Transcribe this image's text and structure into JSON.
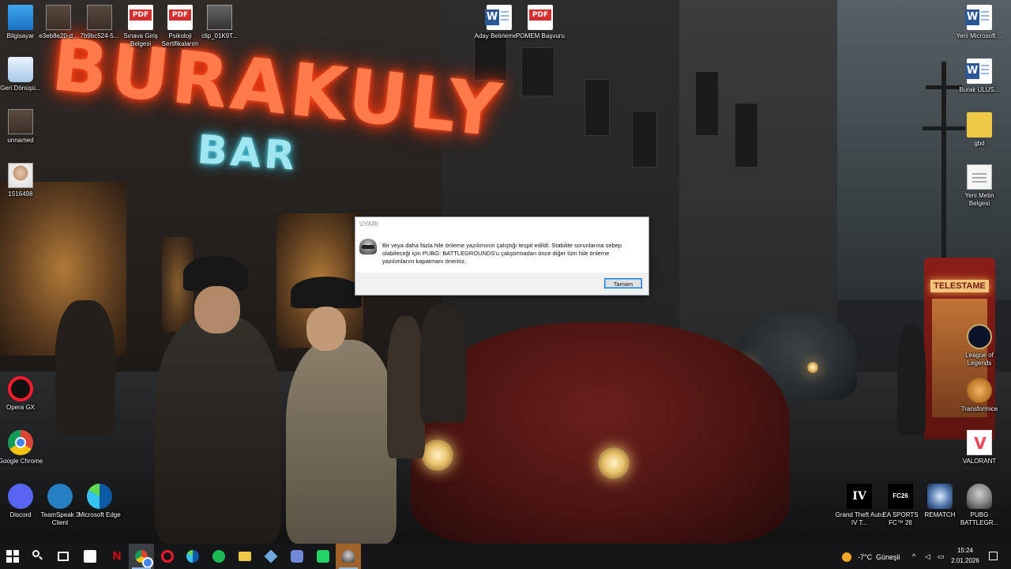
{
  "wallpaper": {
    "neon_title": "BURAKULY",
    "neon_sub": "BAR",
    "booth_sign": "TELESTAME"
  },
  "desktop_icons_left": [
    {
      "label": "Bilgisayar",
      "icon": "computer-icon"
    },
    {
      "label": "e3eb8e20-d...",
      "icon": "photo-icon"
    },
    {
      "label": "7b9bc524-5...",
      "icon": "photo-icon"
    },
    {
      "label": "Sınava Giriş Belgesi",
      "icon": "pdf-icon"
    },
    {
      "label": "Psikoloji Sertifikalarım",
      "icon": "pdf-icon"
    },
    {
      "label": "clip_01K9T...",
      "icon": "video-icon"
    },
    {
      "label": "Geri Dönüşü...",
      "icon": "recycle-bin-icon"
    },
    {
      "label": "unnamed",
      "icon": "photo-icon"
    },
    {
      "label": "1516498",
      "icon": "photo-icon"
    },
    {
      "label": "Opera GX",
      "icon": "opera-gx-icon"
    },
    {
      "label": "Google Chrome",
      "icon": "chrome-icon"
    },
    {
      "label": "Discord",
      "icon": "discord-icon"
    },
    {
      "label": "TeamSpeak 3 Client",
      "icon": "teamspeak-icon"
    },
    {
      "label": "Microsoft Edge",
      "icon": "edge-icon"
    }
  ],
  "desktop_icons_center": [
    {
      "label": "Aday Belirleme ...",
      "icon": "word-icon"
    },
    {
      "label": "POMEM Başvuru",
      "icon": "pdf-icon"
    }
  ],
  "desktop_icons_right": [
    {
      "label": "Yeni Microsoft ...",
      "icon": "word-icon"
    },
    {
      "label": "Burak ULUS...",
      "icon": "word-icon"
    },
    {
      "label": "gbd",
      "icon": "folder-icon"
    },
    {
      "label": "Yeni Metin Belgesi",
      "icon": "text-file-icon"
    },
    {
      "label": "League of Legends",
      "icon": "league-icon"
    },
    {
      "label": "Transformice",
      "icon": "transformice-icon"
    },
    {
      "label": "VALORANT",
      "icon": "valorant-icon"
    },
    {
      "label": "Grand Theft Auto IV T...",
      "icon": "gta-icon"
    },
    {
      "label": "EA SPORTS FC™ 26",
      "icon": "ea-fc-icon"
    },
    {
      "label": "REMATCH",
      "icon": "rematch-icon"
    },
    {
      "label": "PUBG BATTLEGR...",
      "icon": "pubg-icon"
    }
  ],
  "dialog": {
    "title": "UYARI",
    "message": "Bir veya daha fazla hile önleme yazılımının çalıştığı tespit edildi. Stabilite sorunlarına sebep olabileceği için PUBG: BATTLEGROUNDS'u çalıştırmadan önce diğer tüm hile önleme yazılımlarını kapatmanı öneririz.",
    "ok_label": "Tamam"
  },
  "taskbar": {
    "apps": [
      "start-icon",
      "search-icon",
      "task-view-icon",
      "store-icon",
      "netflix-icon",
      "chrome-icon",
      "opera-gx-icon",
      "edge-icon",
      "spotify-icon",
      "file-explorer-icon",
      "network-app-icon",
      "discord-icon",
      "whatsapp-icon",
      "pubg-icon"
    ],
    "weather_temp": "-7°C",
    "weather_desc": "Güneşli",
    "time": "15:24",
    "date": "2.01.2026"
  },
  "colors": {
    "taskbar": "#141617",
    "accent": "#0078d7",
    "neon_red": "#ff7a4a",
    "neon_cyan": "#9fe6f0"
  }
}
